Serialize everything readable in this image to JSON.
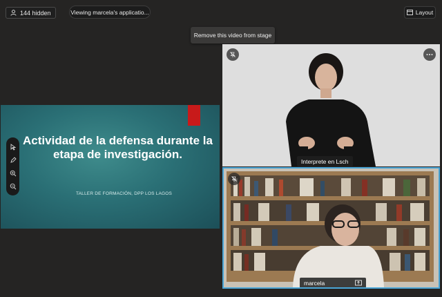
{
  "top_bar": {
    "hidden_count": "144 hidden",
    "viewing_label": "Viewing marcela's applicatio...",
    "layout_label": "Layout"
  },
  "tooltip": {
    "text": "Remove this video from stage"
  },
  "slide": {
    "title": "Actividad de la defensa durante la etapa de investigación.",
    "subtitle": "TALLER DE FORMACIÓN, DPP LOS LAGOS",
    "accent_color": "#c81a1a",
    "tools": [
      "pointer-icon",
      "pen-icon",
      "zoom-in-icon",
      "zoom-out-icon"
    ]
  },
  "videos": [
    {
      "name": "Interprete en Lsch",
      "corner_icons": [
        "unpin-icon",
        "more-options-icon"
      ]
    },
    {
      "name": "marcela",
      "corner_icons": [
        "unpin-icon"
      ],
      "active_border": "#4aa6d8"
    }
  ]
}
